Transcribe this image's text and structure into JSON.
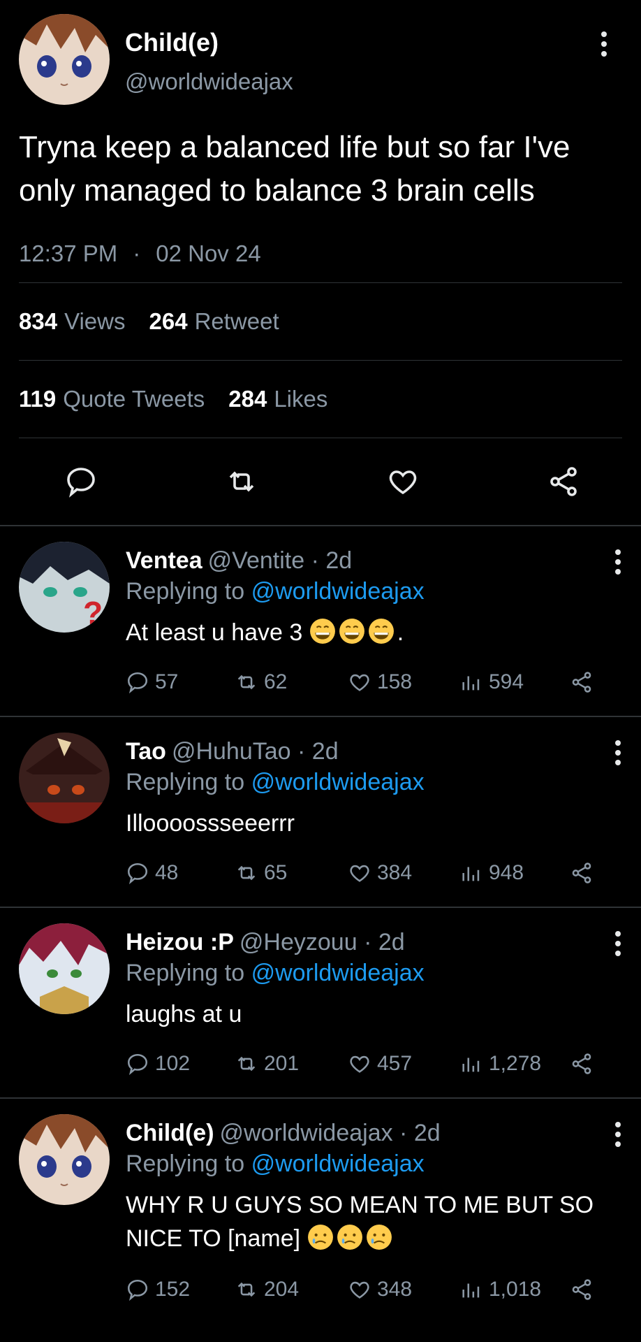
{
  "tweet": {
    "author_name": "Child(e)",
    "author_handle": "@worldwideajax",
    "text": "Tryna keep a balanced life but so far I've only managed to balance 3 brain cells",
    "time": "12:37 PM",
    "date": "02 Nov 24",
    "views_count": "834",
    "views_label": "Views",
    "retweets_count": "264",
    "retweets_label": "Retweet",
    "quotes_count": "119",
    "quotes_label": "Quote Tweets",
    "likes_count": "284",
    "likes_label": "Likes"
  },
  "replies": [
    {
      "name": "Ventea",
      "handle": "@Ventite",
      "age": "2d",
      "replying_prefix": "Replying to",
      "replying_to": "@worldwideajax",
      "text": "At least u have 3",
      "text_suffix": ".",
      "emoji": [
        "grinning-face-emoji",
        "grinning-face-emoji",
        "grinning-face-emoji"
      ],
      "comments": "57",
      "retweets": "62",
      "likes": "158",
      "views": "594"
    },
    {
      "name": "Tao",
      "handle": "@HuhuTao",
      "age": "2d",
      "replying_prefix": "Replying to",
      "replying_to": "@worldwideajax",
      "text": "Illoooossseeerrr",
      "text_suffix": "",
      "comments": "48",
      "retweets": "65",
      "likes": "384",
      "views": "948"
    },
    {
      "name": "Heizou :P",
      "handle": "@Heyzouu",
      "age": "2d",
      "replying_prefix": "Replying to",
      "replying_to": "@worldwideajax",
      "text": "laughs at u",
      "text_suffix": "",
      "comments": "102",
      "retweets": "201",
      "likes": "457",
      "views": "1,278"
    },
    {
      "name": "Child(e)",
      "handle": "@worldwideajax",
      "age": "2d",
      "replying_prefix": "Replying to",
      "replying_to": "@worldwideajax",
      "text": "WHY R U GUYS SO MEAN TO ME BUT SO NICE TO [name]",
      "text_suffix": "",
      "emoji": [
        "crying-face-emoji",
        "crying-face-emoji",
        "crying-face-emoji"
      ],
      "comments": "152",
      "retweets": "204",
      "likes": "348",
      "views": "1,018"
    }
  ],
  "colors": {
    "background": "#000000",
    "text": "#e7e9ea",
    "muted": "#8b98a5",
    "link": "#1d9bf0",
    "divider": "#2f3336"
  }
}
